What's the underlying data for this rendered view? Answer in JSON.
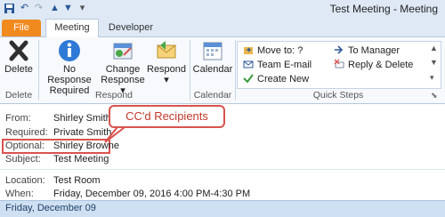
{
  "window": {
    "title": "Test Meeting  -  Meeting"
  },
  "quick_access": {
    "icons": [
      "save-icon",
      "undo-icon",
      "redo-icon",
      "up-arrow-icon",
      "down-arrow-icon",
      "customize-icon"
    ]
  },
  "tabs": [
    {
      "label": "File"
    },
    {
      "label": "Meeting"
    },
    {
      "label": "Developer"
    }
  ],
  "ribbon": {
    "groups": [
      {
        "label": "Delete"
      },
      {
        "label": "Respond"
      },
      {
        "label": "Calendar"
      },
      {
        "label": "Quick Steps"
      }
    ],
    "buttons": {
      "delete": "Delete",
      "no_response_line1": "No Response",
      "no_response_line2": "Required",
      "change_response_line1": "Change",
      "change_response_line2": "Response ▾",
      "respond": "Respond",
      "respond_arrow": "▾",
      "calendar": "Calendar"
    },
    "quick_steps": [
      {
        "label": "Move to: ?"
      },
      {
        "label": "Team E-mail"
      },
      {
        "label": "Create New"
      },
      {
        "label": "To Manager"
      },
      {
        "label": "Reply & Delete"
      }
    ]
  },
  "message": {
    "from_label": "From:",
    "from_value": "Shirley Smith",
    "required_label": "Required:",
    "required_value": "Private Smith",
    "optional_label": "Optional:",
    "optional_value": "Shirley Browne",
    "subject_label": "Subject:",
    "subject_value": "Test Meeting",
    "location_label": "Location:",
    "location_value": "Test Room",
    "when_label": "When:",
    "when_value": "Friday, December 09, 2016 4:00 PM-4:30 PM"
  },
  "callout": {
    "text": "CC'd Recipients",
    "color": "#d9534f"
  },
  "day_bar": {
    "text": "Friday, December 09"
  },
  "colors": {
    "file_tab": "#f08a1f",
    "ribbon_bg": "#f7f9fc",
    "accent_blue": "#2b5797"
  }
}
